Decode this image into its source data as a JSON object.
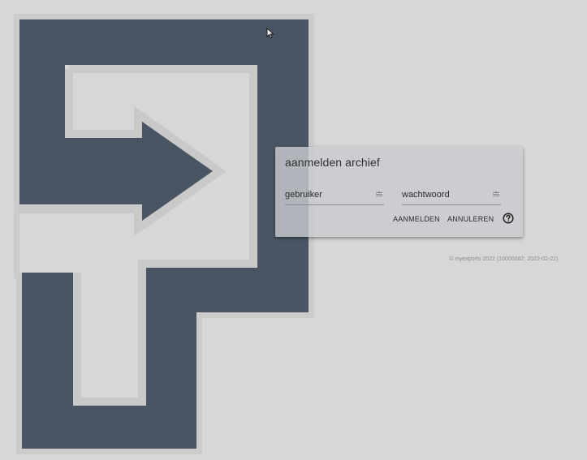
{
  "dialog": {
    "title": "aanmelden archief",
    "username_placeholder": "gebruiker",
    "password_placeholder": "wachtwoord",
    "login_label": "AANMELDEN",
    "cancel_label": "ANNULEREN"
  },
  "footer": {
    "copyright": "© myexports 2022 (10000082; 2022-02-22)"
  },
  "colors": {
    "logo_dark": "#4a5563",
    "logo_outline": "#c7c7c7",
    "background": "#d7d7d7"
  },
  "icons": {
    "field_icon": "key-icon",
    "help_icon": "help-circle-icon",
    "cursor": "mouse-pointer-icon"
  }
}
